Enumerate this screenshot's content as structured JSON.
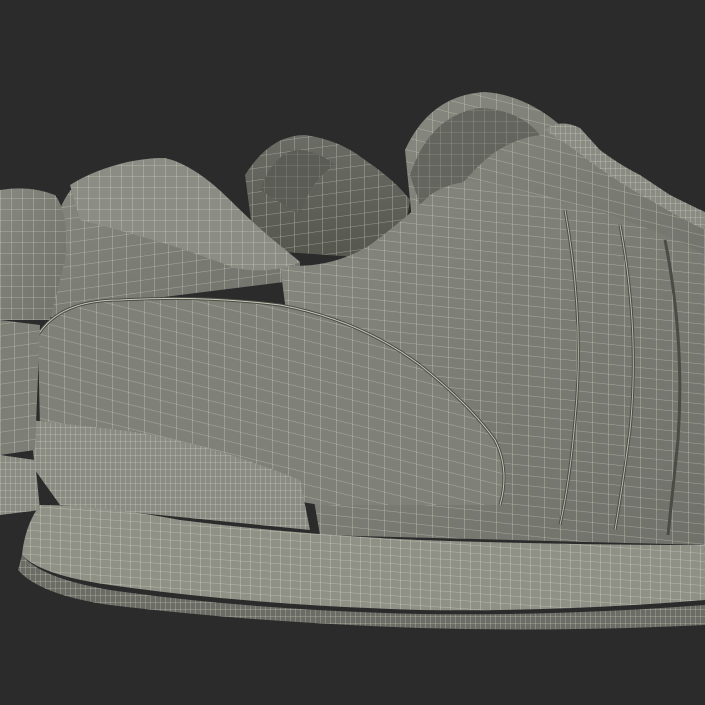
{
  "scene": {
    "subject": "sneaker-wireframe-render",
    "background_color": "#2b2b2b",
    "surface_color": "#7b7d73",
    "surface_shadow_color": "#5f6159",
    "surface_light_color": "#8c8e84",
    "wire_color": "#e9e8d6",
    "seam_color": "#4a4c45"
  }
}
